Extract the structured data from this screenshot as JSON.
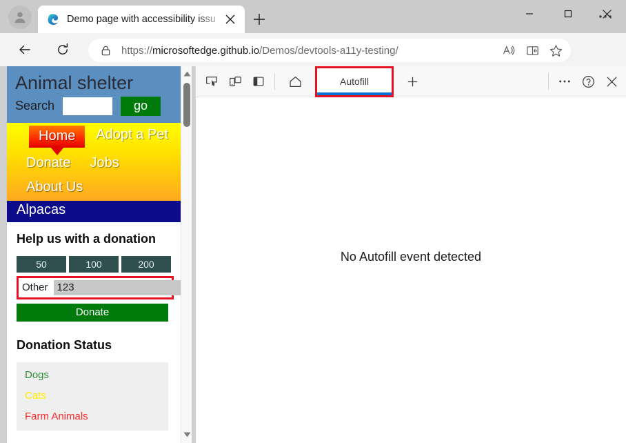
{
  "browser": {
    "tab": {
      "title": "Demo page with accessibility issu",
      "favicon_name": "edge-logo-icon",
      "close_label": "×"
    },
    "newtab_label": "+",
    "window_controls": {
      "minimize": "—",
      "maximize": "□",
      "close": "×"
    },
    "toolbar": {
      "back_name": "back-button",
      "reload_name": "reload-button",
      "url_scheme": "https://",
      "url_host": "microsoftedge.github.io",
      "url_path": "/Demos/devtools-a11y-testing/",
      "url_full": "https://microsoftedge.github.io/Demos/devtools-a11y-testing/",
      "lock_name": "lock-icon",
      "read_aloud": "read-aloud-icon",
      "immersive_reader": "immersive-reader-icon",
      "favorite": "favorite-star-icon",
      "settings": "settings-more-icon"
    }
  },
  "page": {
    "site_title": "Animal shelter",
    "search": {
      "label": "Search",
      "value": "",
      "placeholder": "",
      "button_label": "go"
    },
    "nav": {
      "home": "Home",
      "adopt": "Adopt a Pet",
      "donate": "Donate",
      "jobs": "Jobs",
      "about": "About Us"
    },
    "alpacas_label": "Alpacas",
    "donation": {
      "heading": "Help us with a donation",
      "amounts": [
        "50",
        "100",
        "200"
      ],
      "other_label": "Other",
      "other_value": "123",
      "donate_button": "Donate"
    },
    "status": {
      "heading": "Donation Status",
      "items": [
        {
          "label": "Dogs",
          "color": "#2e8b36"
        },
        {
          "label": "Cats",
          "color": "#ffee00"
        },
        {
          "label": "Farm Animals",
          "color": "#ff2a2a"
        }
      ]
    },
    "scrollbar": {
      "up": "▲",
      "down": "▼"
    }
  },
  "devtools": {
    "icons": {
      "inspect": "inspect-element-icon",
      "device": "device-emulation-icon",
      "dock": "dock-side-icon",
      "home": "home-icon",
      "more": "more-tools-icon",
      "help": "help-icon",
      "close": "close-devtools-icon"
    },
    "active_tab": "Autofill",
    "add_tab_label": "+",
    "empty_message": "No Autofill event detected"
  },
  "colors": {
    "accent_red": "#e81123",
    "accent_blue": "#0a74d1",
    "header_blue": "#5b8fc0",
    "nav_yellow": "#ffff00",
    "nav_orange": "#ffa820",
    "green": "#007a0b",
    "slate": "#2f4f4f",
    "alpacas_blue": "#0b0b8c"
  }
}
